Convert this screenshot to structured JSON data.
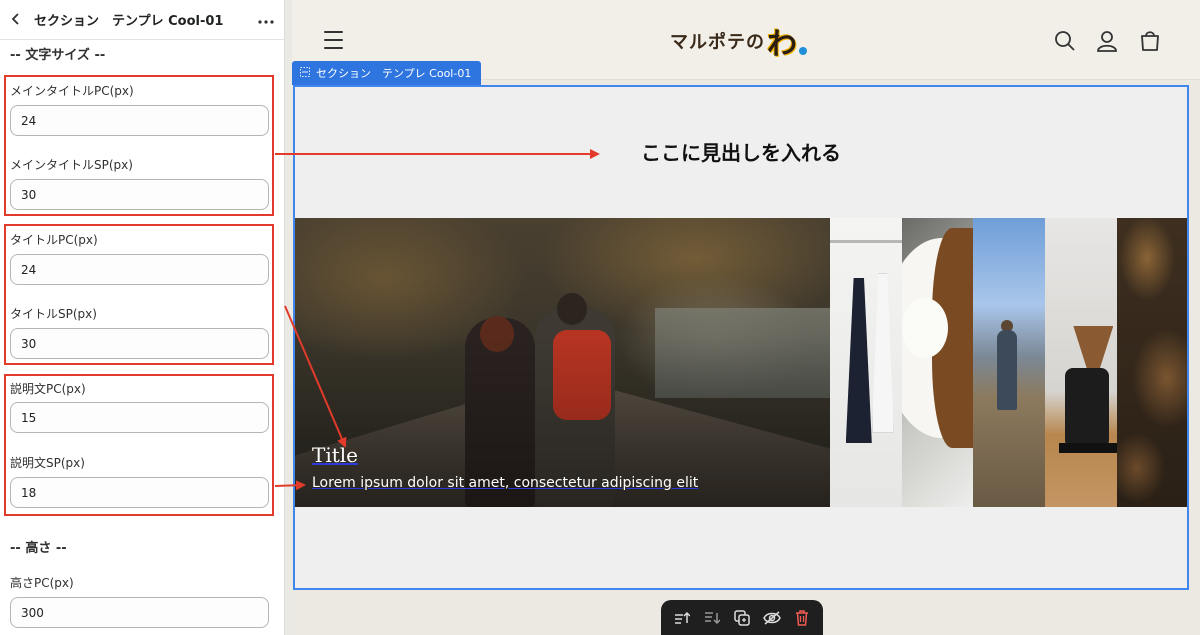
{
  "panel": {
    "title": "セクション　テンプレ Cool-01",
    "back_icon": "chevron-left-icon",
    "more_icon": "more-horizontal-icon",
    "font_section_heading": "-- 文字サイズ --",
    "height_section_heading": "-- 高さ --",
    "fields": [
      {
        "label": "メインタイトルPC(px)",
        "value": "24"
      },
      {
        "label": "メインタイトルSP(px)",
        "value": "30"
      },
      {
        "label": "タイトルPC(px)",
        "value": "24"
      },
      {
        "label": "タイトルSP(px)",
        "value": "30"
      },
      {
        "label": "説明文PC(px)",
        "value": "15"
      },
      {
        "label": "説明文SP(px)",
        "value": "18"
      },
      {
        "label": "高さPC(px)",
        "value": "300"
      }
    ]
  },
  "preview": {
    "logo_text": "マルポテの",
    "logo_big": "わ",
    "section_tag": "セクション　テンプレ Cool-01",
    "heading": "ここに見出しを入れる",
    "card_title": "Title",
    "card_description": "Lorem ipsum dolor sit amet, consectetur adipiscing elit"
  },
  "colors": {
    "accent_blue": "#2f75df",
    "annotation_red": "#e23b2a"
  }
}
